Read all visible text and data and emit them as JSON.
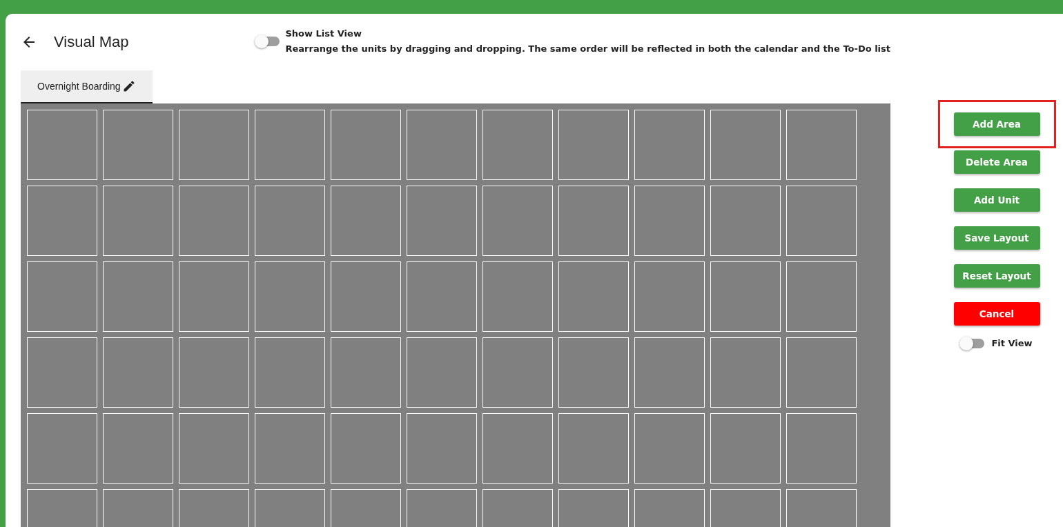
{
  "header": {
    "title": "Visual Map"
  },
  "list_view": {
    "label": "Show List View",
    "on": false,
    "hint": "Rearrange the units by dragging and dropping. The same order will be reflected in both the calendar and the To-Do list"
  },
  "tabs": [
    {
      "label": "Overnight Boarding",
      "selected": true
    }
  ],
  "actions": [
    {
      "label": "Add Area",
      "kind": "primary",
      "highlighted": true
    },
    {
      "label": "Delete Area",
      "kind": "primary",
      "highlighted": false
    },
    {
      "label": "Add Unit",
      "kind": "primary",
      "highlighted": false
    },
    {
      "label": "Save Layout",
      "kind": "primary",
      "highlighted": false
    },
    {
      "label": "Reset Layout",
      "kind": "primary",
      "highlighted": false
    },
    {
      "label": "Cancel",
      "kind": "danger",
      "highlighted": false
    }
  ],
  "fit_view": {
    "label": "Fit View",
    "on": false
  }
}
